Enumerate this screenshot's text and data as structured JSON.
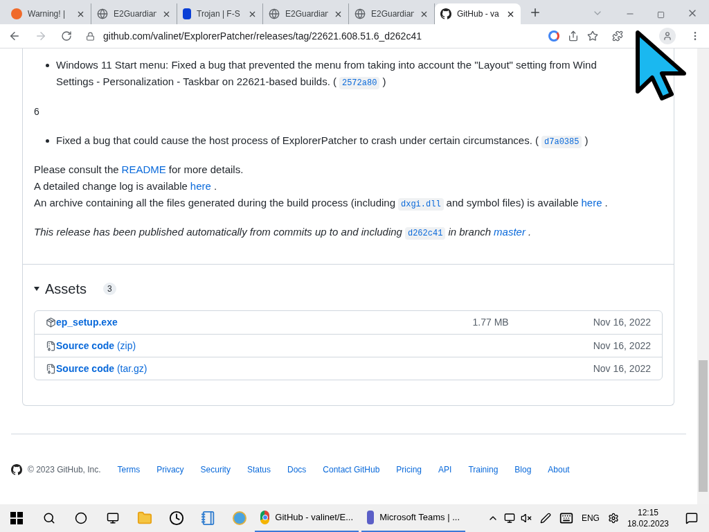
{
  "browser": {
    "tabs": [
      {
        "title": "Warning! | ",
        "kind": "warning",
        "selected": false
      },
      {
        "title": "E2Guardian",
        "kind": "globe",
        "selected": false
      },
      {
        "title": "Trojan | F-S",
        "kind": "fsecure",
        "selected": false
      },
      {
        "title": "E2Guardian",
        "kind": "globe",
        "selected": false
      },
      {
        "title": "E2Guardian",
        "kind": "globe",
        "selected": false
      },
      {
        "title": "GitHub - va",
        "kind": "github",
        "selected": true
      }
    ],
    "url": "github.com/valinet/ExplorerPatcher/releases/tag/22621.608.51.6_d262c41"
  },
  "release": {
    "bullets_top": [
      {
        "parts": [
          {
            "kind": "text",
            "text": "Windows 11 Start menu: Fixed a bug that prevented the menu from taking into account the \"Layout\" setting from Wind"
          }
        ],
        "line2": [
          {
            "kind": "text",
            "text": "Settings - Personalization - Taskbar on 22621-based builds. ("
          },
          {
            "kind": "code",
            "text": "2572a80"
          },
          {
            "kind": "text",
            "text": ")"
          }
        ]
      }
    ],
    "heading": "6",
    "bullets": [
      [
        {
          "kind": "text",
          "text": "Fixed a bug that could cause the host process of ExplorerPatcher to crash under certain circumstances. ("
        },
        {
          "kind": "code",
          "text": "d7a0385"
        },
        {
          "kind": "text",
          "text": ")"
        }
      ]
    ],
    "lines": [
      [
        {
          "kind": "text",
          "text": "Please consult the"
        },
        {
          "kind": "link",
          "text": "README"
        },
        {
          "kind": "text",
          "text": "for more details."
        }
      ],
      [
        {
          "kind": "text",
          "text": "A detailed change log is available"
        },
        {
          "kind": "link",
          "text": "here"
        },
        {
          "kind": "text",
          "text": "."
        }
      ],
      [
        {
          "kind": "text",
          "text": "An archive containing all the files generated during the build process (including"
        },
        {
          "kind": "code",
          "text": "dxgi.dll"
        },
        {
          "kind": "text",
          "text": "and symbol files) is available"
        },
        {
          "kind": "link",
          "text": "here"
        },
        {
          "kind": "text",
          "text": "."
        }
      ]
    ],
    "note": [
      {
        "kind": "text",
        "text": "This release has been published automatically from commits up to and including"
      },
      {
        "kind": "code",
        "text": "d262c41"
      },
      {
        "kind": "text",
        "text": "in branch"
      },
      {
        "kind": "link",
        "text": "master"
      },
      {
        "kind": "text",
        "text": "."
      }
    ],
    "assets": {
      "title": "Assets",
      "count": "3",
      "expanded": true,
      "items": [
        {
          "kind": "package",
          "name": "ep_setup.exe",
          "size": "1.77 MB",
          "date": "Nov 16, 2022"
        },
        {
          "kind": "zip",
          "name": "Source code",
          "suffix": "(zip)",
          "date": "Nov 16, 2022"
        },
        {
          "kind": "zip",
          "name": "Source code",
          "suffix": "(tar.gz)",
          "date": "Nov 16, 2022"
        }
      ]
    }
  },
  "footer": {
    "copyright": "© 2023 GitHub, Inc.",
    "links": [
      "Terms",
      "Privacy",
      "Security",
      "Status",
      "Docs",
      "Contact GitHub",
      "Pricing",
      "API",
      "Training",
      "Blog",
      "About"
    ]
  },
  "taskbar": {
    "apps": [
      {
        "title": "GitHub - valinet/E...",
        "kind": "chrome"
      },
      {
        "title": "Microsoft Teams | ...",
        "kind": "teams"
      }
    ],
    "language": "ENG",
    "time": "12:15",
    "date": "18.02.2023"
  }
}
